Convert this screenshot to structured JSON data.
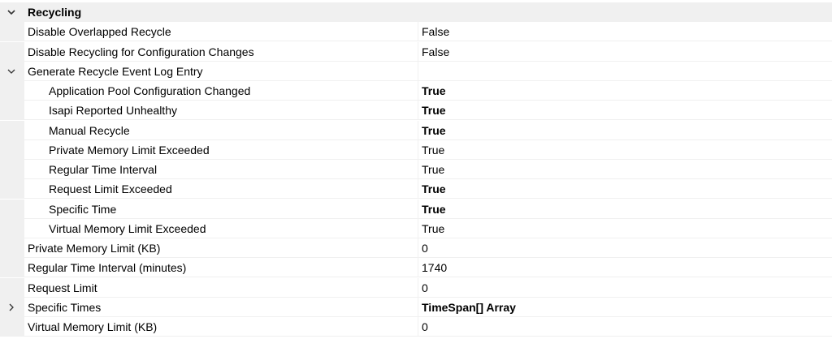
{
  "property_grid": {
    "category": {
      "label": "Recycling",
      "expanded": true,
      "icon": "chevron-down-icon"
    },
    "rows": [
      {
        "name": "Disable Overlapped Recycle",
        "value": "False",
        "level": 0,
        "bold": false,
        "expander": null
      },
      {
        "name": "Disable Recycling for Configuration Changes",
        "value": "False",
        "level": 0,
        "bold": false,
        "expander": null
      },
      {
        "name": "Generate Recycle Event Log Entry",
        "value": "",
        "level": 0,
        "bold": false,
        "expander": "chevron-down-icon"
      },
      {
        "name": "Application Pool Configuration Changed",
        "value": "True",
        "level": 1,
        "bold": true,
        "expander": null
      },
      {
        "name": "Isapi Reported Unhealthy",
        "value": "True",
        "level": 1,
        "bold": true,
        "expander": null
      },
      {
        "name": "Manual Recycle",
        "value": "True",
        "level": 1,
        "bold": true,
        "expander": null
      },
      {
        "name": "Private Memory Limit Exceeded",
        "value": "True",
        "level": 1,
        "bold": false,
        "expander": null
      },
      {
        "name": "Regular Time Interval",
        "value": "True",
        "level": 1,
        "bold": false,
        "expander": null
      },
      {
        "name": "Request Limit Exceeded",
        "value": "True",
        "level": 1,
        "bold": true,
        "expander": null
      },
      {
        "name": "Specific Time",
        "value": "True",
        "level": 1,
        "bold": true,
        "expander": null
      },
      {
        "name": "Virtual Memory Limit Exceeded",
        "value": "True",
        "level": 1,
        "bold": false,
        "expander": null
      },
      {
        "name": "Private Memory Limit (KB)",
        "value": "0",
        "level": 0,
        "bold": false,
        "expander": null
      },
      {
        "name": "Regular Time Interval (minutes)",
        "value": "1740",
        "level": 0,
        "bold": false,
        "expander": null
      },
      {
        "name": "Request Limit",
        "value": "0",
        "level": 0,
        "bold": false,
        "expander": null
      },
      {
        "name": "Specific Times",
        "value": "TimeSpan[] Array",
        "level": 0,
        "bold": true,
        "expander": "chevron-right-icon"
      },
      {
        "name": "Virtual Memory Limit (KB)",
        "value": "0",
        "level": 0,
        "bold": false,
        "expander": null
      }
    ]
  },
  "colors": {
    "category_background": "#f0f0f0",
    "gutter_background": "#f0f0f0",
    "grid_line": "#f0f0f0",
    "text": "#000000",
    "chevron": "#333333"
  }
}
